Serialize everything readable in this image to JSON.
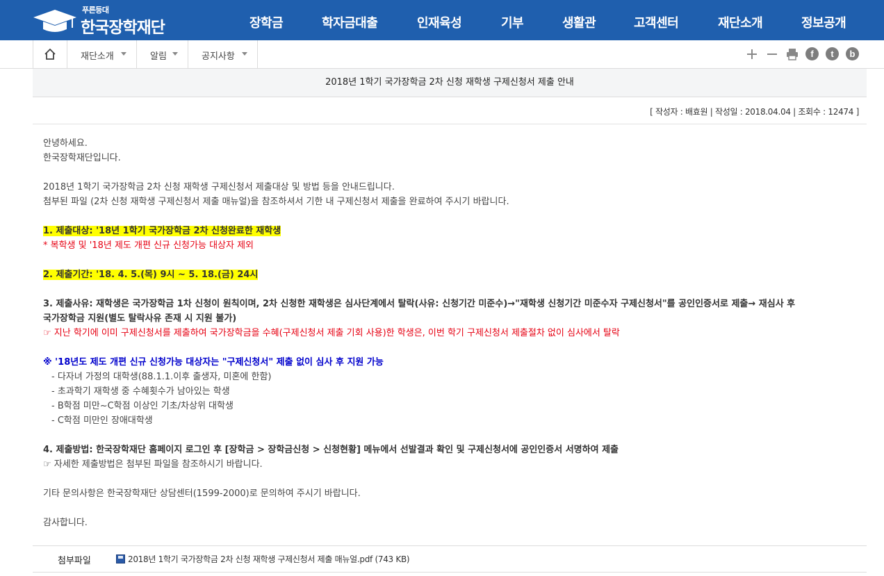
{
  "header": {
    "logo_sub": "푸른등대",
    "logo_name": "한국장학재단",
    "menu": [
      "장학금",
      "학자금대출",
      "인재육성",
      "기부",
      "생활관",
      "고객센터",
      "재단소개",
      "정보공개"
    ]
  },
  "breadcrumb": [
    "재단소개",
    "알림",
    "공지사항"
  ],
  "toolbar": {
    "icons": [
      "plus-icon",
      "minus-icon",
      "print-icon",
      "facebook-icon",
      "twitter-icon",
      "blog-icon"
    ],
    "facebook_glyph": "f",
    "twitter_glyph": "t",
    "blog_glyph": "b"
  },
  "post": {
    "title": "2018년 1학기 국가장학금 2차 신청 재학생 구제신청서 제출 안내",
    "meta": "[ 작성자 : 배효원 | 작성일 : 2018.04.04 | 조회수 : 12474 ]",
    "greeting1": "안녕하세요.",
    "greeting2": "한국장학재단입니다.",
    "intro1": "2018년 1학기 국가장학금 2차 신청 재학생 구제신청서 제출대상 및 방법 등을 안내드립니다.",
    "intro2": "첨부된 파일 (2차 신청 재학생 구제신청서 제출 매뉴얼)을 참조하셔서 기한 내 구제신청서 제출을 완료하여 주시기 바랍니다.",
    "target": "1. 제출대상: '18년 1학기 국가장학금 2차 신청완료한 재학생",
    "target_note": " * 복학생 및 '18년 제도 개편 신규 신청가능 대상자 제외",
    "period": "2. 제출기간: '18. 4. 5.(목) 9시 ~ 5. 18.(금) 24시",
    "reason1": "3. 제출사유: 재학생은 국가장학금 1차 신청이 원칙이며, 2차 신청한 재학생은 심사단계에서 탈락(사유: 신청기간 미준수)→\"재학생 신청기간 미준수자 구제신청서\"를 공인인증서로 제출→ 재심사 후",
    "reason2": "국가장학금 지원(별도 탈락사유 존재 시 지원 불가)",
    "reason_note": "☞ 지난 학기에 이미 구제신청서를 제출하여 국가장학금을 수혜(구제신청서 제출 기회 사용)한 학생은, 이번 학기 구제신청서 제출절차 없이 심사에서 탈락",
    "notice": "※ '18년도 제도 개편 신규 신청가능 대상자는 \"구제신청서\" 제출 없이 심사 후 지원 가능",
    "notice_items": [
      "- 다자녀 가정의 대학생(88.1.1.이후 출생자, 미혼에 한함)",
      "- 초과학기 재학생 중 수혜횟수가 남아있는 학생",
      "- B학점 미만~C학점 이상인 기초/차상위 대학생",
      "- C학점 미만인 장애대학생"
    ],
    "method": "4. 제출방법: 한국장학재단 홈페이지 로그인 후 [장학금 > 장학금신청 > 신청현황] 메뉴에서 선발결과 확인 및 구제신청서에 공인인증서 서명하여 제출",
    "method_note": "☞ 자세한 제출방법은 첨부된 파일을 참조하시기 바랍니다.",
    "contact": "기타 문의사항은 한국장학재단 상담센터(1599-2000)로 문의하여 주시기 바랍니다.",
    "closing": "감사합니다."
  },
  "attachment": {
    "label": "첨부파일",
    "file": "2018년 1학기 국가장학금 2차 신청 재학생 구제신청서 제출 매뉴얼.pdf (743 KB)"
  },
  "colors": {
    "header_bg": "#1f5fae",
    "highlight": "#ffff00",
    "red_text": "#e60012",
    "blue_text": "#0000cc"
  }
}
